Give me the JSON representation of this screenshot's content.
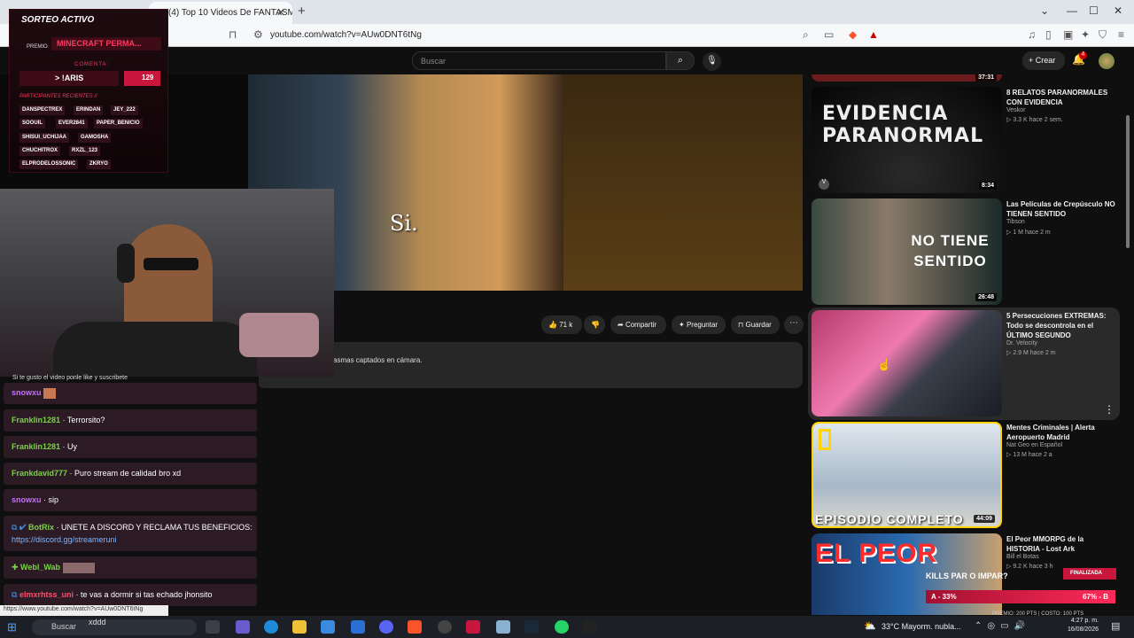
{
  "browser": {
    "tab_title": "(4) Top 10 Videos De FANTASMA",
    "url": "youtube.com/watch?v=AUw0DNT6tNg",
    "new_tab": "+",
    "min": "—",
    "max": "☐",
    "close": "✕",
    "status_url": "https://www.youtube.com/watch?v=AUw0DNT6tNg"
  },
  "youtube": {
    "search_placeholder": "Buscar",
    "create_label": "Crear",
    "notif_count": "4"
  },
  "video": {
    "subtitle": "Si.",
    "like_count": "71 k",
    "share_label": "Compartir",
    "ask_label": "Preguntar",
    "save_label": "Guardar",
    "description": "asmas captados en cámara."
  },
  "sidebar": [
    {
      "title": "",
      "channel": "",
      "meta": "",
      "duration": "37:31"
    },
    {
      "title": "8 RELATOS PARANORMALES CON EVIDENCIA",
      "channel": "Veskor",
      "meta": "▷ 3.3 K  hace 2 sem.",
      "duration": "8:34",
      "thumb_text": "EVIDENCIA PARANORMAL"
    },
    {
      "title": "Las Películas de Crepúsculo NO TIENEN SENTIDO",
      "channel": "Tibson",
      "meta": "▷ 1 M  hace 2 m",
      "duration": "26:48",
      "thumb_text": "NO TIENE SENTIDO"
    },
    {
      "title": "5 Persecuciones EXTREMAS: Todo se descontrola en el ÚLTIMO SEGUNDO",
      "channel": "Dr. Velocity",
      "meta": "▷ 2.9 M  hace 2 m",
      "duration": ""
    },
    {
      "title": "Mentes Criminales | Alerta Aeropuerto Madrid",
      "channel": "Nat Geo en Español",
      "meta": "▷ 13 M  hace 2 a",
      "duration": "44:09",
      "thumb_text": "EPISODIO COMPLETO"
    },
    {
      "title": "El Peor MMORPG de la HISTORIA - Lost Ark",
      "channel": "Bill el Botas",
      "meta": "▷ 9.2 K  hace 3 h",
      "duration": "",
      "thumb_text": "EL PEOR"
    }
  ],
  "sorteo": {
    "header": "SORTEO ACTIVO",
    "premio_label": "PREMIO",
    "premio_value": "MINECRAFT PERMA...",
    "comenta": "COMENTA:",
    "keyword": "> !ARIS",
    "count": "129",
    "participants_header": "PARTICIPANTES RECIENTES //",
    "participants": [
      "DANSPECTREX",
      "ERINDAN",
      "JEY_222",
      "SOOUIL",
      "EVER2841",
      "PAPER_BENICIO",
      "SHISUI_UCHIJAA",
      "GAMOSHA",
      "CHUCHITROX",
      "RXZL_123",
      "ELPRODELOSSONIC",
      "ZKRYO"
    ]
  },
  "chat": {
    "caption": "Si te gusto el video ponle like y suscribete",
    "messages": [
      {
        "user": "snowxu",
        "text": "",
        "color": "#c86cff"
      },
      {
        "user": "Franklin1281",
        "text": "· Terrorsito?",
        "color": "#7bd148"
      },
      {
        "user": "Franklin1281",
        "text": "· Uy",
        "color": "#7bd148"
      },
      {
        "user": "Frankdavid777",
        "text": "· Puro stream de calidad bro xd",
        "color": "#7bd148"
      },
      {
        "user": "snowxu",
        "text": "· sip",
        "color": "#c86cff"
      },
      {
        "user": "BotRix",
        "text": "· UNETE A DISCORD Y RECLAMA TUS BENEFICIOS:",
        "link": "https://discord.gg/streameruni",
        "color": "#7bd148"
      },
      {
        "user": "Webl_Wab",
        "text": "",
        "color": "#7bd148"
      },
      {
        "user": "elmxrhtss_uni",
        "text": "· te vas a dormir si tas echado jhonsito",
        "color": "#ff4d6d"
      }
    ]
  },
  "overlay": {
    "kills_question": "KILLS PAR O IMPAR?",
    "finalizada": "FINALIZADA",
    "bar_left": "A - 33%",
    "bar_right": "67% - B",
    "premio_costo": "PREMIO: 200 PTS | COSTO: 100 PTS"
  },
  "taskbar": {
    "search": "Buscar",
    "typed": "xddd",
    "weather": "33°C  Mayorm. nubla...",
    "time": "4:27 p. m.",
    "date": "16/08/2026"
  }
}
